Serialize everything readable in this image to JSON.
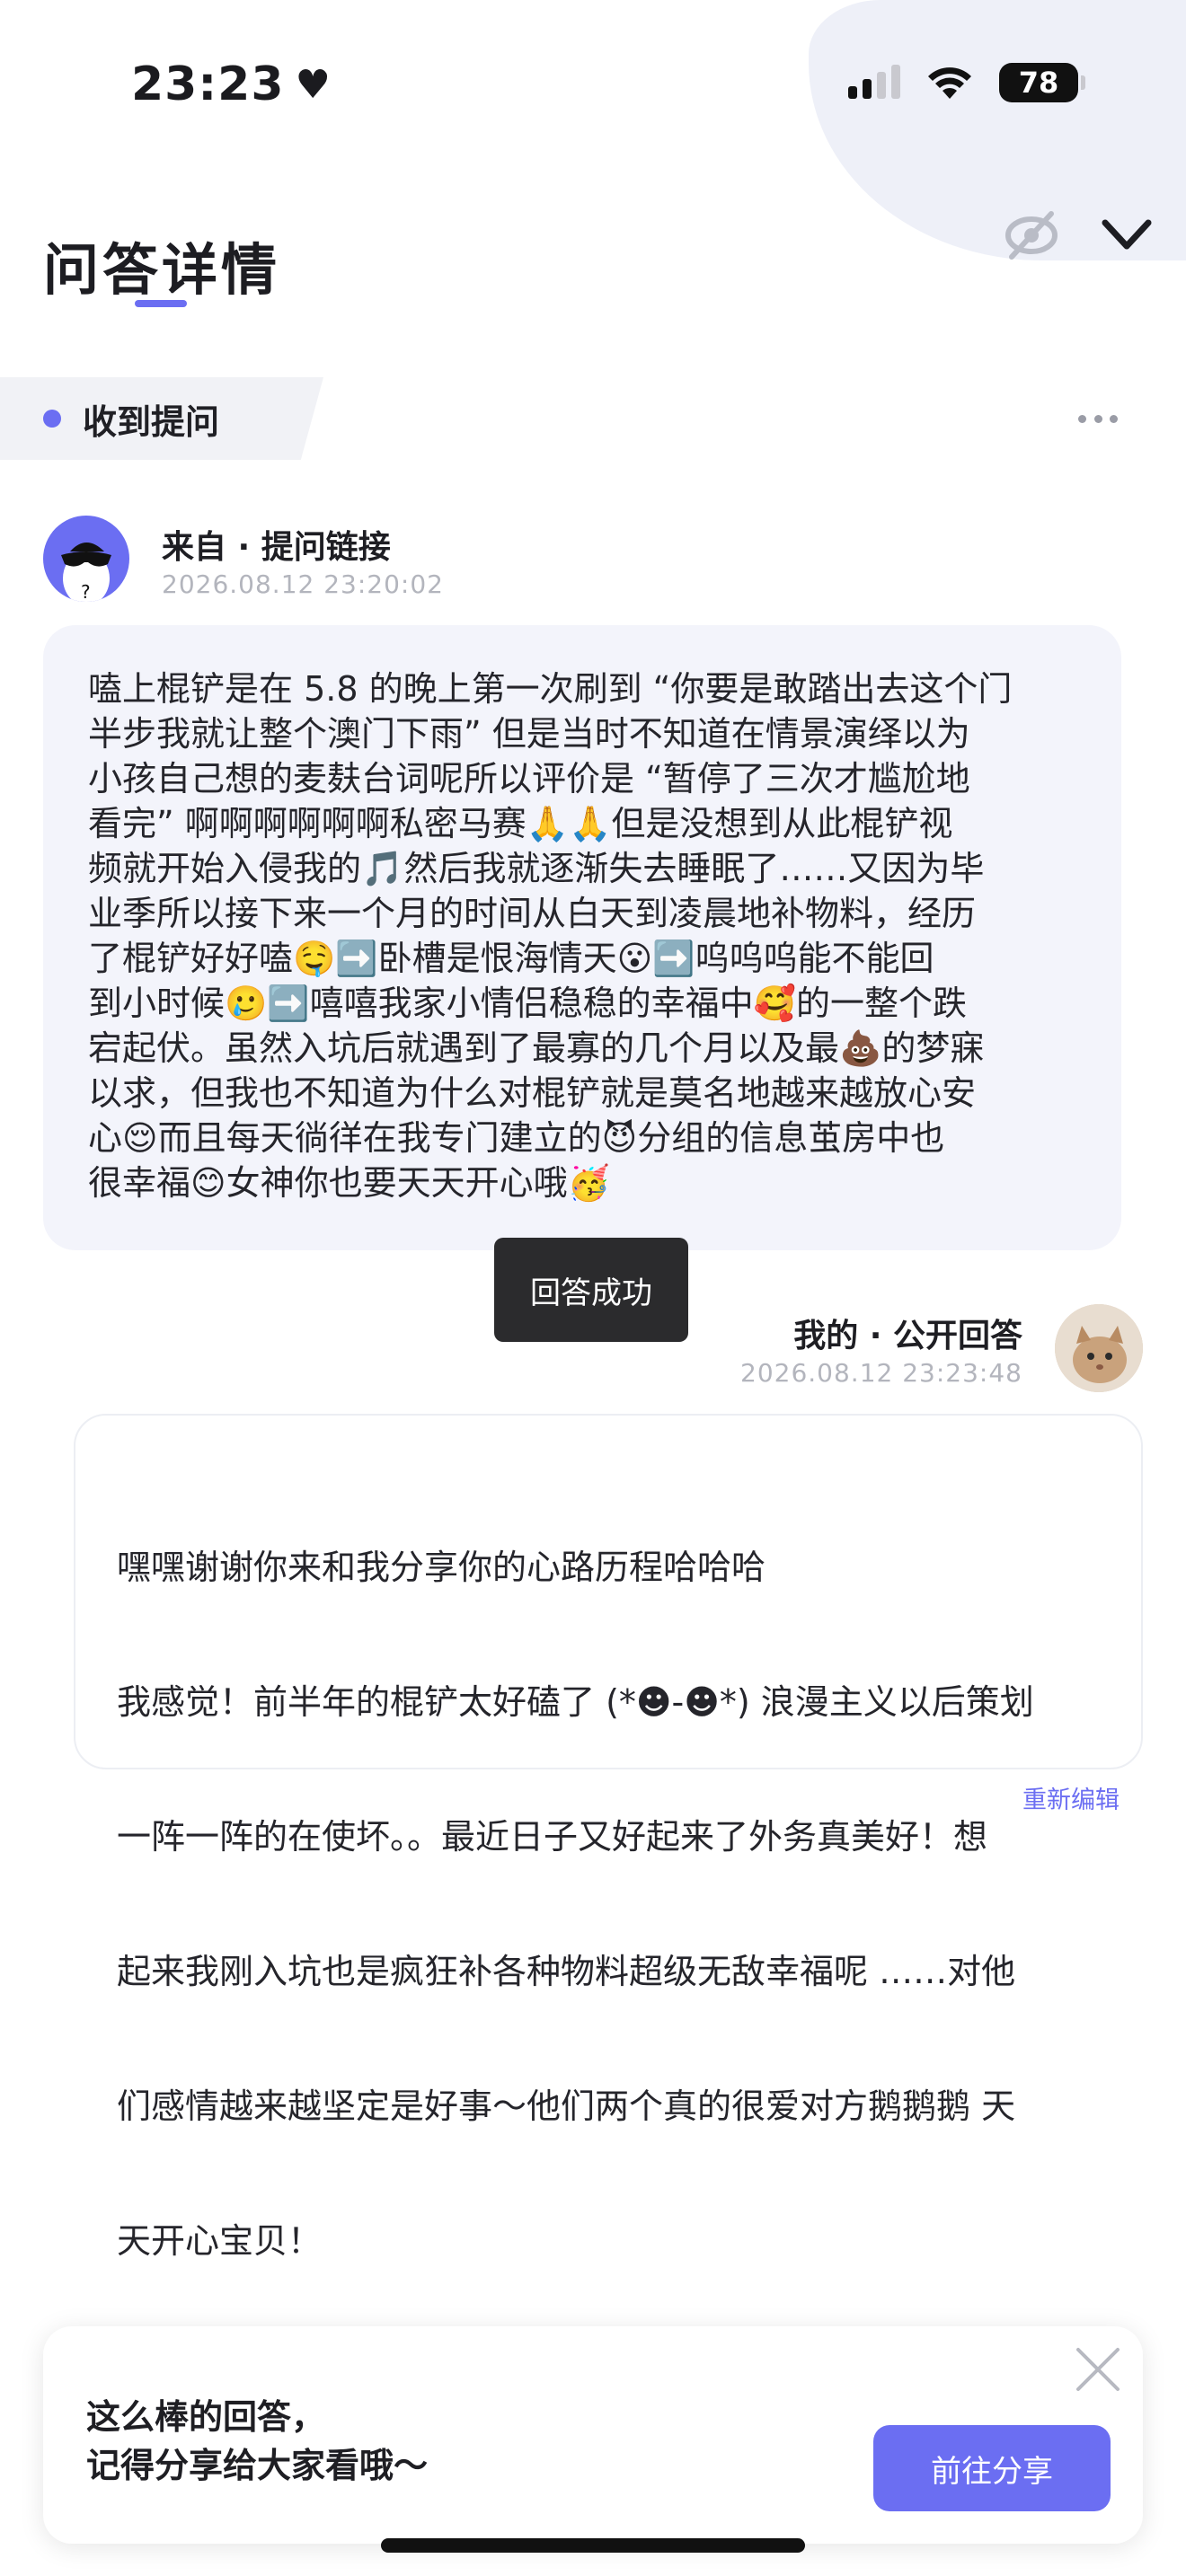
{
  "status_bar": {
    "time": "23:23",
    "battery": "78",
    "icons": [
      "heart-icon",
      "signal-icon",
      "wifi-icon",
      "battery-icon"
    ]
  },
  "header": {
    "title": "问答详情",
    "icons": [
      "eye-off-icon",
      "chevron-down-icon"
    ]
  },
  "question": {
    "tag": "收到提问",
    "source": "来自 · 提问链接",
    "time": "2026.08.12 23:20:02",
    "lines": [
      "嗑上棍铲是在 5.8 的晚上第一次刷到 “你要是敢踏出去这个门",
      "半步我就让整个澳门下雨” 但是当时不知道在情景演绎以为",
      "小孩自己想的麦麸台词呢所以评价是 “暂停了三次才尴尬地",
      "看完” 啊啊啊啊啊啊私密马赛🙏🙏但是没想到从此棍铲视",
      "频就开始入侵我的🎵然后我就逐渐失去睡眠了……又因为毕",
      "业季所以接下来一个月的时间从白天到凌晨地补物料，经历",
      "了棍铲好好嗑🤤➡️卧槽是恨海情天😮➡️呜呜呜能不能回",
      "到小时候🥲➡️嘻嘻我家小情侣稳稳的幸福中🥰的一整个跌",
      "宕起伏。虽然入坑后就遇到了最寡的几个月以及最💩的梦寐",
      "以求，但我也不知道为什么对棍铲就是莫名地越来越放心安",
      "心😌而且每天徜徉在我专门建立的😈分组的信息茧房中也",
      "很幸福😊女神你也要天天开心哦🥳"
    ]
  },
  "toast": "回答成功",
  "answer": {
    "label": "我的 · 公开回答",
    "time": "2026.08.12 23:23:48",
    "lines": [
      "嘿嘿谢谢你来和我分享你的心路历程哈哈哈",
      "我感觉！前半年的棍铲太好磕了 (*☻-☻*) 浪漫主义以后策划",
      "一阵一阵的在使坏。。最近日子又好起来了外务真美好！想",
      "起来我刚入坑也是疯狂补各种物料超级无敌幸福呢 ……对他",
      "们感情越来越坚定是好事～他们两个真的很爱对方鹅鹅鹅 天",
      "天开心宝贝！"
    ],
    "re_edit": "重新编辑"
  },
  "share": {
    "line1": "这么棒的回答，",
    "line2": "记得分享给大家看哦～",
    "button": "前往分享"
  },
  "colors": {
    "accent": "#6b6ef2",
    "question_bg": "#f3f4fb",
    "toast_bg": "#2b2b2d"
  }
}
